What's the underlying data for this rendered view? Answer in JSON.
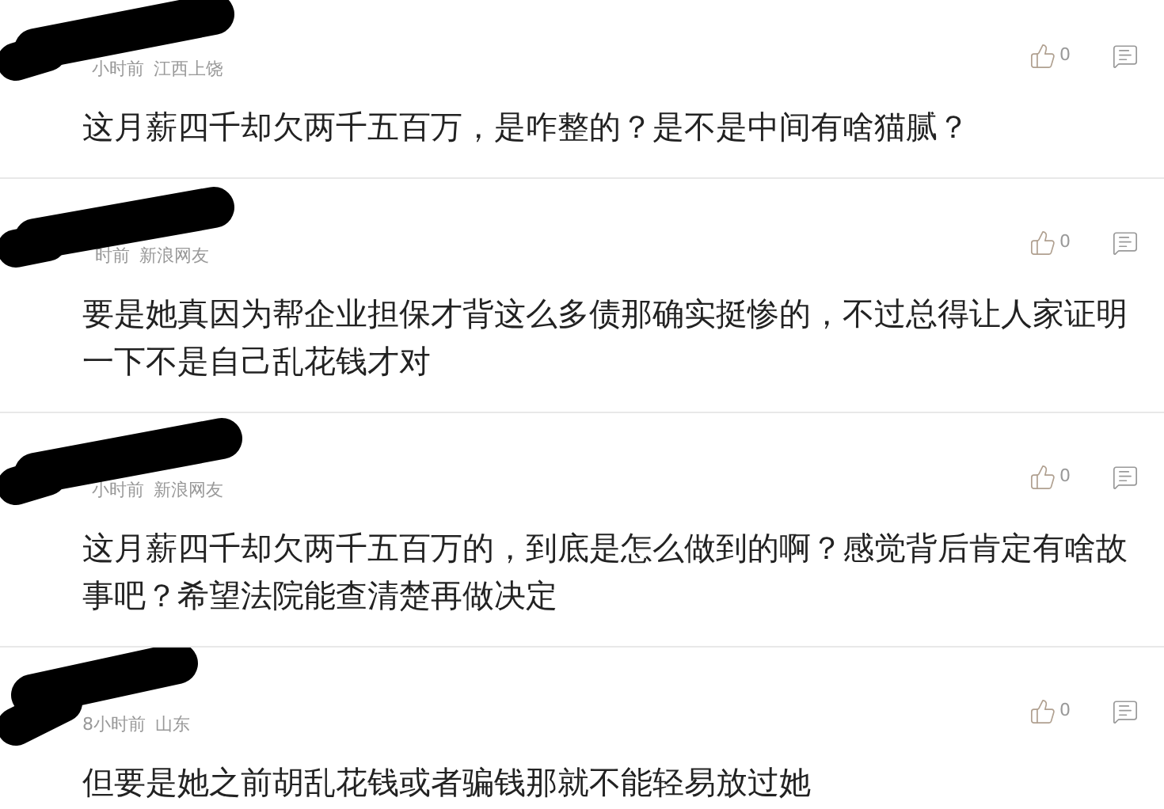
{
  "comments": [
    {
      "time": "小时前",
      "location": "江西上饶",
      "text": "这月薪四千却欠两千五百万，是咋整的？是不是中间有啥猫腻？",
      "likes": "0"
    },
    {
      "time": "时前",
      "location": "新浪网友",
      "text": "要是她真因为帮企业担保才背这么多债那确实挺惨的，不过总得让人家证明一下不是自己乱花钱才对",
      "likes": "0"
    },
    {
      "time": "小时前",
      "location": "新浪网友",
      "text": "这月薪四千却欠两千五百万的，到底是怎么做到的啊？感觉背后肯定有啥故事吧？希望法院能查清楚再做决定",
      "likes": "0"
    },
    {
      "time": "8小时前",
      "location": "山东",
      "text": "但要是她之前胡乱花钱或者骗钱那就不能轻易放过她",
      "likes": "0"
    }
  ]
}
